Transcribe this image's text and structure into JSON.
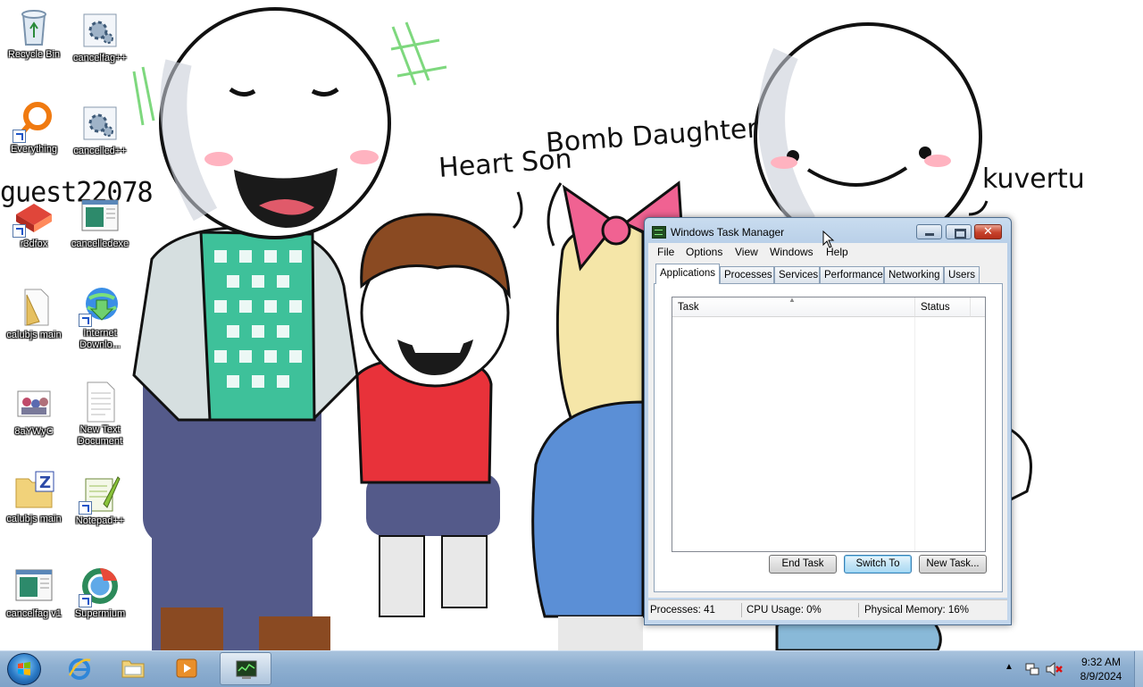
{
  "wallpaper": {
    "labels": [
      "Heart Son",
      "Bomb Daughter",
      "kuvertu"
    ],
    "guest_text": "guest22078"
  },
  "desktop_icons": [
    {
      "label": "Recycle Bin",
      "icon": "recycle-bin-icon"
    },
    {
      "label": "cancelfag++",
      "icon": "settings-app-icon"
    },
    {
      "label": "Everything",
      "icon": "everything-search-icon"
    },
    {
      "label": "cancelled++",
      "icon": "settings-app-icon"
    },
    {
      "label": "r3dfox",
      "icon": "r3dfox-browser-icon"
    },
    {
      "label": "cancelledexe",
      "icon": "window-app-icon"
    },
    {
      "label": "calubjs main",
      "icon": "folder-icon"
    },
    {
      "label": "Internet Downlo...",
      "icon": "internet-download-manager-icon"
    },
    {
      "label": "8aYWyC",
      "icon": "image-file-icon"
    },
    {
      "label": "New Text Document",
      "icon": "text-document-icon"
    },
    {
      "label": "calubjs main",
      "icon": "zip-folder-icon"
    },
    {
      "label": "Notepad++",
      "icon": "notepad-plus-plus-icon"
    },
    {
      "label": "cancelfag v1",
      "icon": "window-app-icon"
    },
    {
      "label": "Supermium",
      "icon": "supermium-browser-icon"
    }
  ],
  "task_manager": {
    "title": "Windows Task Manager",
    "menu": [
      "File",
      "Options",
      "View",
      "Windows",
      "Help"
    ],
    "tabs": [
      "Applications",
      "Processes",
      "Services",
      "Performance",
      "Networking",
      "Users"
    ],
    "active_tab": "Applications",
    "columns": [
      "Task",
      "Status"
    ],
    "buttons": {
      "end_task": "End Task",
      "switch_to": "Switch To",
      "new_task": "New Task..."
    },
    "status": {
      "processes": "Processes: 41",
      "cpu": "CPU Usage: 0%",
      "memory": "Physical Memory: 16%"
    }
  },
  "taskbar": {
    "pinned": [
      "internet-explorer-icon",
      "windows-explorer-icon",
      "media-player-icon",
      "task-manager-icon"
    ],
    "active": "task-manager-icon",
    "clock": {
      "time": "9:32 AM",
      "date": "8/9/2024"
    }
  },
  "colors": {
    "taskbar": "#8fb0d1",
    "titlebar": "#c9dcef",
    "close_button": "#c7422b"
  }
}
